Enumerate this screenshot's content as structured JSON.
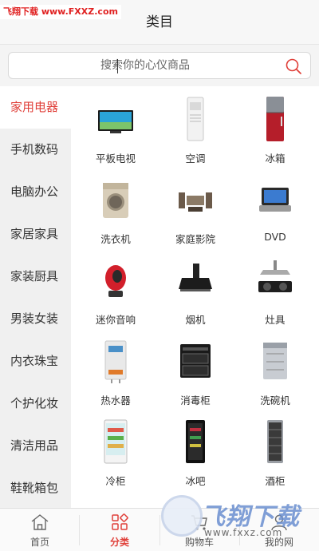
{
  "watermark": {
    "top": "飞翔下载 www.FXXZ.com",
    "bottom_big": "飞翔下载",
    "bottom_url": "www.fxxz.com"
  },
  "header": {
    "title": "类目"
  },
  "search": {
    "placeholder": "搜索你的心仪商品"
  },
  "sidebar": {
    "items": [
      {
        "label": "家用电器",
        "active": true
      },
      {
        "label": "手机数码",
        "active": false
      },
      {
        "label": "电脑办公",
        "active": false
      },
      {
        "label": "家居家具",
        "active": false
      },
      {
        "label": "家装厨具",
        "active": false
      },
      {
        "label": "男装女装",
        "active": false
      },
      {
        "label": "内衣珠宝",
        "active": false
      },
      {
        "label": "个护化妆",
        "active": false
      },
      {
        "label": "清洁用品",
        "active": false
      },
      {
        "label": "鞋靴箱包",
        "active": false
      }
    ]
  },
  "products": [
    {
      "label": "平板电视",
      "icon": "tv-icon"
    },
    {
      "label": "空调",
      "icon": "air-conditioner-icon"
    },
    {
      "label": "冰箱",
      "icon": "refrigerator-icon"
    },
    {
      "label": "洗衣机",
      "icon": "washing-machine-icon"
    },
    {
      "label": "家庭影院",
      "icon": "home-theater-icon"
    },
    {
      "label": "DVD",
      "icon": "dvd-player-icon"
    },
    {
      "label": "迷你音响",
      "icon": "mini-speaker-icon"
    },
    {
      "label": "烟机",
      "icon": "range-hood-icon"
    },
    {
      "label": "灶具",
      "icon": "gas-stove-icon"
    },
    {
      "label": "热水器",
      "icon": "water-heater-icon"
    },
    {
      "label": "消毒柜",
      "icon": "disinfection-cabinet-icon"
    },
    {
      "label": "洗碗机",
      "icon": "dishwasher-icon"
    },
    {
      "label": "冷柜",
      "icon": "display-freezer-icon"
    },
    {
      "label": "冰吧",
      "icon": "mini-bar-fridge-icon"
    },
    {
      "label": "酒柜",
      "icon": "wine-cabinet-icon"
    }
  ],
  "tabbar": {
    "items": [
      {
        "label": "首页",
        "icon": "home-icon",
        "active": false
      },
      {
        "label": "分类",
        "icon": "category-icon",
        "active": true
      },
      {
        "label": "购物车",
        "icon": "cart-icon",
        "active": false
      },
      {
        "label": "我的网",
        "icon": "user-icon",
        "active": false
      }
    ]
  },
  "colors": {
    "accent": "#e0403a",
    "sidebar_bg": "#f0f0f0",
    "header_bg": "#f7f7f7"
  }
}
